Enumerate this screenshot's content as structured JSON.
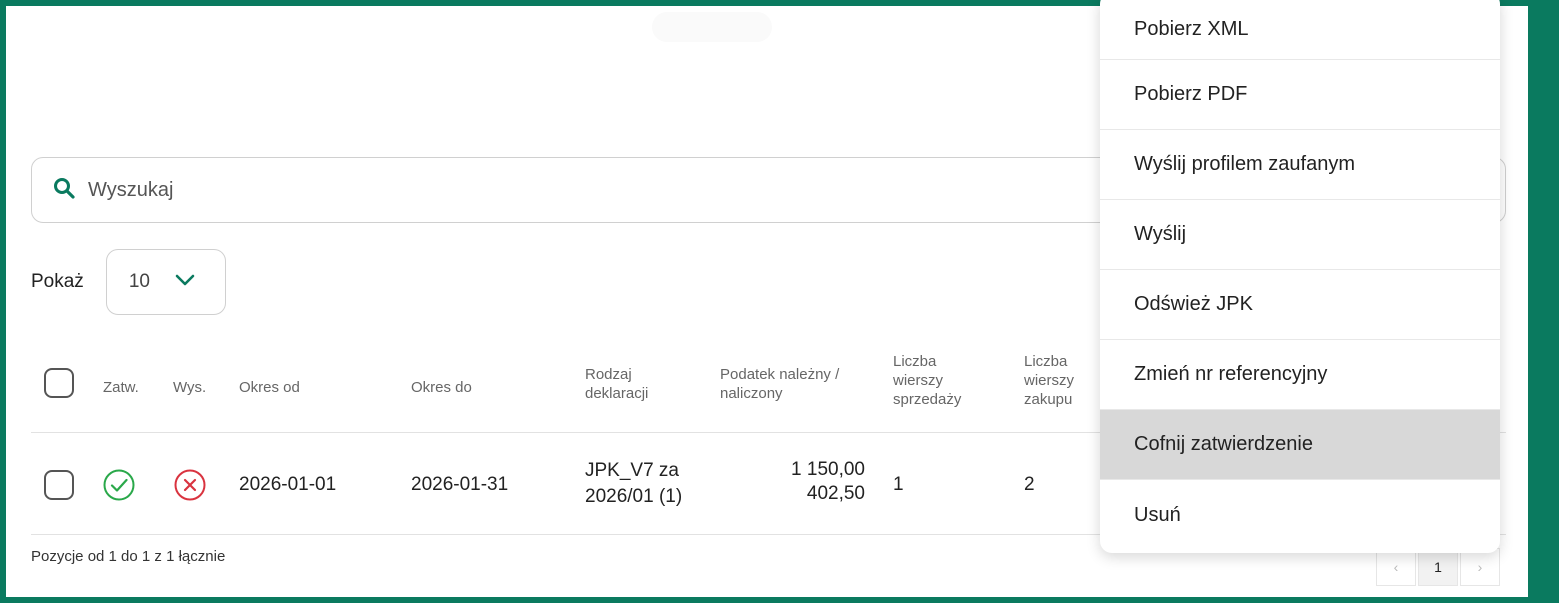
{
  "search": {
    "placeholder": "Wyszukaj"
  },
  "show": {
    "label": "Pokaż",
    "value": "10"
  },
  "table": {
    "headers": {
      "approved": "Zatw.",
      "sent": "Wys.",
      "period_from": "Okres od",
      "period_to": "Okres do",
      "declaration_type": [
        "Rodzaj",
        "deklaracji"
      ],
      "tax": [
        "Podatek należny /",
        "naliczony"
      ],
      "sales_rows": [
        "Liczba",
        "wierszy",
        "sprzedaży"
      ],
      "purchase_rows": [
        "Liczba",
        "wierszy",
        "zakupu"
      ]
    },
    "rows": [
      {
        "approved": "green-check-circle-icon",
        "sent": "red-x-circle-icon",
        "period_from": "2026-01-01",
        "period_to": "2026-01-31",
        "declaration_type": [
          "JPK_V7 za",
          "2026/01 (1)"
        ],
        "tax_due": "1 150,00",
        "tax_input": "402,50",
        "sales_rows": "1",
        "purchase_rows": "2"
      }
    ]
  },
  "footer": {
    "info": "Pozycje od 1 do 1 z 1 łącznie"
  },
  "pagination": {
    "prev": "‹",
    "current": "1",
    "next": "›"
  },
  "context_menu": {
    "items": [
      "Pobierz XML",
      "Pobierz PDF",
      "Wyślij profilem zaufanym",
      "Wyślij",
      "Odśwież JPK",
      "Zmień nr referencyjny",
      "Cofnij zatwierdzenie",
      "Usuń"
    ],
    "highlighted": "Cofnij zatwierdzenie"
  },
  "colors": {
    "accent": "#0a7a5f",
    "approved": "#2aa84a",
    "not_sent": "#d9333f",
    "highlight": "#d8d8d8"
  }
}
